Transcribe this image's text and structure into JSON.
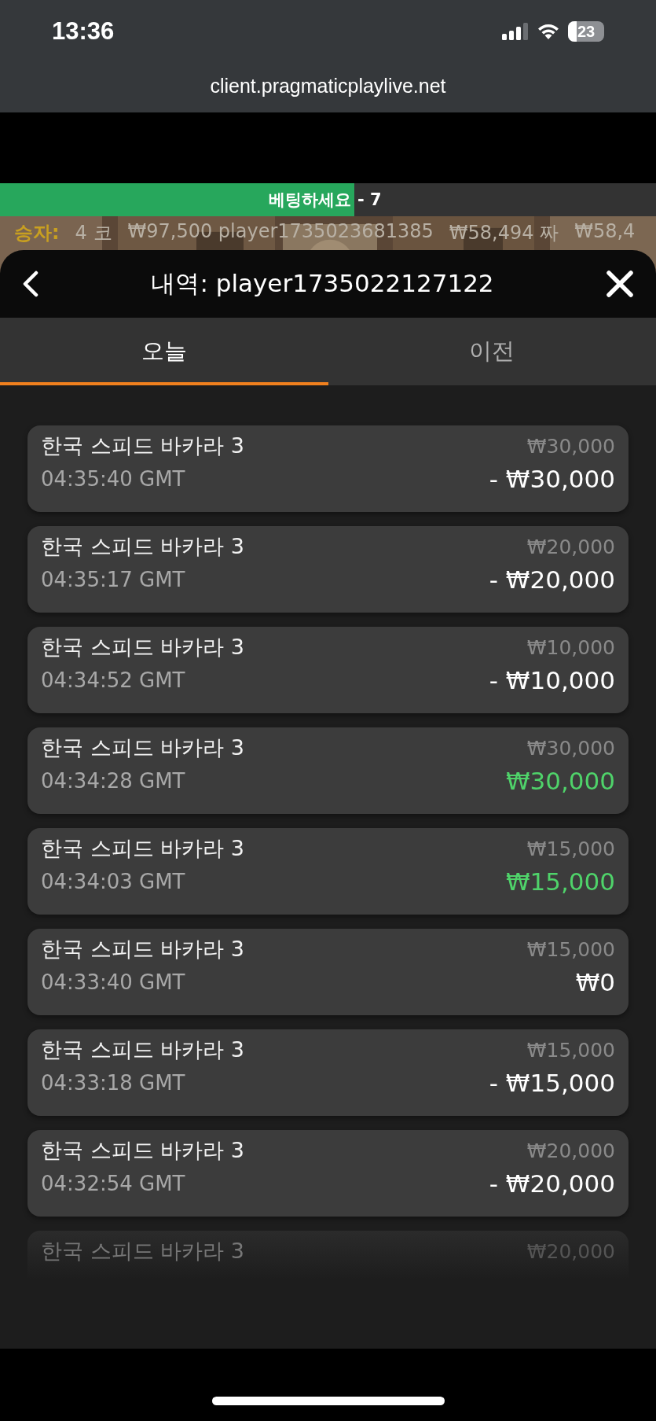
{
  "status_bar": {
    "time": "13:36",
    "battery": "23"
  },
  "browser": {
    "url": "client.pragmaticplaylive.net"
  },
  "betting_bar": {
    "label": "베팅하세요",
    "countdown": "- 7",
    "level": 0.54
  },
  "winners_ticker": {
    "label": "승자:",
    "entries": [
      "4 코",
      "₩97,500 player1735023681385",
      "₩58,494 짜",
      "₩58,4"
    ]
  },
  "history": {
    "title": "내역: player1735022127122",
    "tabs": [
      {
        "label": "오늘",
        "selected": true
      },
      {
        "label": "이전",
        "selected": false
      }
    ],
    "rows": [
      {
        "game": "한국 스피드 바카라 3",
        "bet": "₩30,000",
        "time": "04:35:40 GMT",
        "result": "- ₩30,000",
        "kind": "loss",
        "faded": false
      },
      {
        "game": "한국 스피드 바카라 3",
        "bet": "₩20,000",
        "time": "04:35:17 GMT",
        "result": "- ₩20,000",
        "kind": "loss",
        "faded": false
      },
      {
        "game": "한국 스피드 바카라 3",
        "bet": "₩10,000",
        "time": "04:34:52 GMT",
        "result": "- ₩10,000",
        "kind": "loss",
        "faded": false
      },
      {
        "game": "한국 스피드 바카라 3",
        "bet": "₩30,000",
        "time": "04:34:28 GMT",
        "result": "₩30,000",
        "kind": "win",
        "faded": false
      },
      {
        "game": "한국 스피드 바카라 3",
        "bet": "₩15,000",
        "time": "04:34:03 GMT",
        "result": "₩15,000",
        "kind": "win",
        "faded": false
      },
      {
        "game": "한국 스피드 바카라 3",
        "bet": "₩15,000",
        "time": "04:33:40 GMT",
        "result": "₩0",
        "kind": "even",
        "faded": false
      },
      {
        "game": "한국 스피드 바카라 3",
        "bet": "₩15,000",
        "time": "04:33:18 GMT",
        "result": "- ₩15,000",
        "kind": "loss",
        "faded": false
      },
      {
        "game": "한국 스피드 바카라 3",
        "bet": "₩20,000",
        "time": "04:32:54 GMT",
        "result": "- ₩20,000",
        "kind": "loss",
        "faded": false
      },
      {
        "game": "한국 스피드 바카라 3",
        "bet": "₩20,000",
        "faded": true
      }
    ]
  }
}
